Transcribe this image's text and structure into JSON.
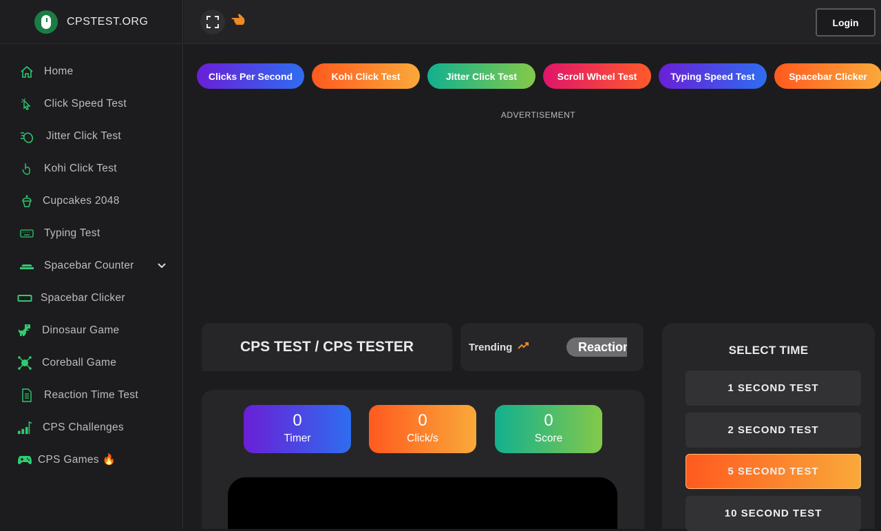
{
  "brand": {
    "name": "CPSTEST.ORG"
  },
  "sidebar": {
    "items": [
      {
        "label": "Home",
        "icon": "home-icon"
      },
      {
        "label": "Click Speed Test",
        "icon": "cursor-click-icon"
      },
      {
        "label": "Jitter Click Test",
        "icon": "mouse-jitter-icon"
      },
      {
        "label": "Kohi Click Test",
        "icon": "hand-pointer-icon"
      },
      {
        "label": "Cupcakes 2048",
        "icon": "cupcake-icon"
      },
      {
        "label": "Typing Test",
        "icon": "keyboard-icon"
      },
      {
        "label": "Spacebar Counter",
        "icon": "spacebar-icon",
        "has_submenu": true
      },
      {
        "label": "Spacebar Clicker",
        "icon": "spacebar-key-icon"
      },
      {
        "label": "Dinosaur Game",
        "icon": "dinosaur-icon"
      },
      {
        "label": "Coreball Game",
        "icon": "coreball-icon"
      },
      {
        "label": "Reaction Time Test",
        "icon": "document-icon"
      },
      {
        "label": "CPS Challenges",
        "icon": "chart-icon"
      },
      {
        "label": "CPS Games 🔥",
        "icon": "gamepad-icon"
      }
    ]
  },
  "topbar": {
    "login_label": "Login"
  },
  "chips": [
    "Clicks Per Second",
    "Kohi Click Test",
    "Jitter Click Test",
    "Scroll Wheel Test",
    "Typing Speed Test",
    "Spacebar Clicker"
  ],
  "advertisement_label": "ADVERTISEMENT",
  "main": {
    "title": "CPS TEST / CPS TESTER",
    "trending_label": "Trending",
    "trending_item": "Reaction Time Test",
    "stats": {
      "timer": {
        "value": "0",
        "label": "Timer"
      },
      "clicks": {
        "value": "0",
        "label": "Click/s"
      },
      "score": {
        "value": "0",
        "label": "Score"
      }
    }
  },
  "time_select": {
    "title": "SELECT TIME",
    "options": [
      "1 SECOND TEST",
      "2 SECOND TEST",
      "5 SECOND TEST",
      "10 SECOND TEST"
    ],
    "selected": "5 SECOND TEST"
  },
  "colors": {
    "accent_green": "#2ecc71",
    "accent_orange": "#ff5a1f",
    "background": "#1c1c1e"
  }
}
